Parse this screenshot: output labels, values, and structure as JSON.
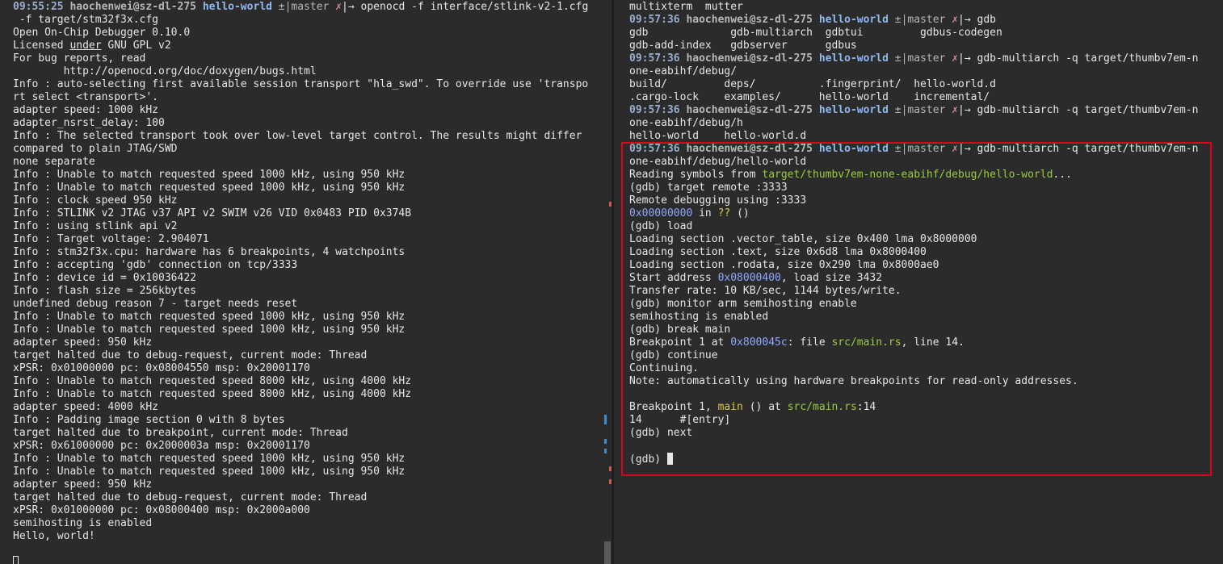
{
  "colors": {
    "background": "#2b2b2b",
    "text": "#e6e6e6",
    "prompt_time": "#9aaed0",
    "prompt_dir": "#8fb8f0",
    "path_green": "#9ccb3c",
    "address_blue": "#8ea7ff",
    "function_yellow": "#d6c94a",
    "highlight_border": "#e0001b"
  },
  "left_terminal": {
    "prompt": {
      "time": "09:55:25",
      "user_host": "haochenwei@sz-dl-275",
      "dir": "hello-world",
      "git": "±|master ",
      "dirty": "✗",
      "arrow": "|→ ",
      "command": "openocd -f interface/stlink-v2-1.cfg",
      "command_cont": " -f target/stm32f3x.cfg"
    },
    "license_prefix": "Licensed ",
    "license_under": "under",
    "license_suffix": " GNU GPL v2",
    "lines": [
      "Open On-Chip Debugger 0.10.0",
      "For bug reports, read",
      "        http://openocd.org/doc/doxygen/bugs.html",
      "Info : auto-selecting first available session transport \"hla_swd\". To override use 'transpo",
      "rt select <transport>'.",
      "adapter speed: 1000 kHz",
      "adapter_nsrst_delay: 100",
      "Info : The selected transport took over low-level target control. The results might differ",
      "compared to plain JTAG/SWD",
      "none separate",
      "Info : Unable to match requested speed 1000 kHz, using 950 kHz",
      "Info : Unable to match requested speed 1000 kHz, using 950 kHz",
      "Info : clock speed 950 kHz",
      "Info : STLINK v2 JTAG v37 API v2 SWIM v26 VID 0x0483 PID 0x374B",
      "Info : using stlink api v2",
      "Info : Target voltage: 2.904071",
      "Info : stm32f3x.cpu: hardware has 6 breakpoints, 4 watchpoints",
      "Info : accepting 'gdb' connection on tcp/3333",
      "Info : device id = 0x10036422",
      "Info : flash size = 256kbytes",
      "undefined debug reason 7 - target needs reset",
      "Info : Unable to match requested speed 1000 kHz, using 950 kHz",
      "Info : Unable to match requested speed 1000 kHz, using 950 kHz",
      "adapter speed: 950 kHz",
      "target halted due to debug-request, current mode: Thread",
      "xPSR: 0x01000000 pc: 0x08004550 msp: 0x20001170",
      "Info : Unable to match requested speed 8000 kHz, using 4000 kHz",
      "Info : Unable to match requested speed 8000 kHz, using 4000 kHz",
      "adapter speed: 4000 kHz",
      "Info : Padding image section 0 with 8 bytes",
      "target halted due to breakpoint, current mode: Thread",
      "xPSR: 0x61000000 pc: 0x2000003a msp: 0x20001170",
      "Info : Unable to match requested speed 1000 kHz, using 950 kHz",
      "Info : Unable to match requested speed 1000 kHz, using 950 kHz",
      "adapter speed: 950 kHz",
      "target halted due to debug-request, current mode: Thread",
      "xPSR: 0x01000000 pc: 0x08000400 msp: 0x2000a000",
      "semihosting is enabled",
      "Hello, world!"
    ]
  },
  "right_terminal": {
    "prompt": {
      "time": "09:57:36",
      "user_host": "haochenwei@sz-dl-275",
      "dir": "hello-world",
      "git": "±|master ",
      "dirty": "✗",
      "arrow": "|→ "
    },
    "top_line": "multixterm  mutter",
    "cmd_gdb": "gdb",
    "completions_gdb": [
      "gdb             gdb-multiarch  gdbtui         gdbus-codegen",
      "gdb-add-index   gdbserver      gdbus"
    ],
    "cmd_debug": "gdb-multiarch -q target/thumbv7em-n",
    "cmd_debug_cont": "one-eabihf/debug/",
    "completions_debug": [
      "build/         deps/          .fingerprint/  hello-world.d",
      ".cargo-lock    examples/      hello-world    incremental/"
    ],
    "cmd_h": "gdb-multiarch -q target/thumbv7em-n",
    "cmd_h_cont": "one-eabihf/debug/h",
    "completions_h": "hello-world    hello-world.d",
    "cmd_full": "gdb-multiarch -q target/thumbv7em-n",
    "cmd_full_cont": "one-eabihf/debug/hello-world",
    "gdb": {
      "reading_prefix": "Reading symbols from ",
      "reading_path": "target/thumbv7em-none-eabihf/debug/hello-world",
      "reading_suffix": "...",
      "target_remote": "(gdb) target remote :3333",
      "remote_debugging": "Remote debugging using :3333",
      "frame_addr": "0x00000000",
      "frame_in": " in ",
      "frame_func": "??",
      "frame_args": " ()",
      "load_cmd": "(gdb) load",
      "load_vector": "Loading section .vector_table, size 0x400 lma 0x8000000",
      "load_text": "Loading section .text, size 0x6d8 lma 0x8000400",
      "load_rodata": "Loading section .rodata, size 0x290 lma 0x8000ae0",
      "start_prefix": "Start address ",
      "start_addr": "0x08000400",
      "start_suffix": ", load size 3432",
      "transfer": "Transfer rate: 10 KB/sec, 1144 bytes/write.",
      "monitor_cmd": "(gdb) monitor arm semihosting enable",
      "semihosting": "semihosting is enabled",
      "break_cmd": "(gdb) break main",
      "bp_prefix": "Breakpoint 1 at ",
      "bp_addr": "0x800045c",
      "bp_file_prefix": ": file ",
      "bp_file": "src/main.rs",
      "bp_suffix": ", line 14.",
      "continue_cmd": "(gdb) continue",
      "continuing": "Continuing.",
      "note": "Note: automatically using hardware breakpoints for read-only addresses.",
      "hit_prefix": "Breakpoint 1, ",
      "hit_func": "main",
      "hit_mid": " () at ",
      "hit_file": "src/main.rs",
      "hit_suffix": ":14",
      "source_line": "14      #[entry]",
      "next_cmd": "(gdb) next",
      "final_prompt": "(gdb) "
    }
  }
}
